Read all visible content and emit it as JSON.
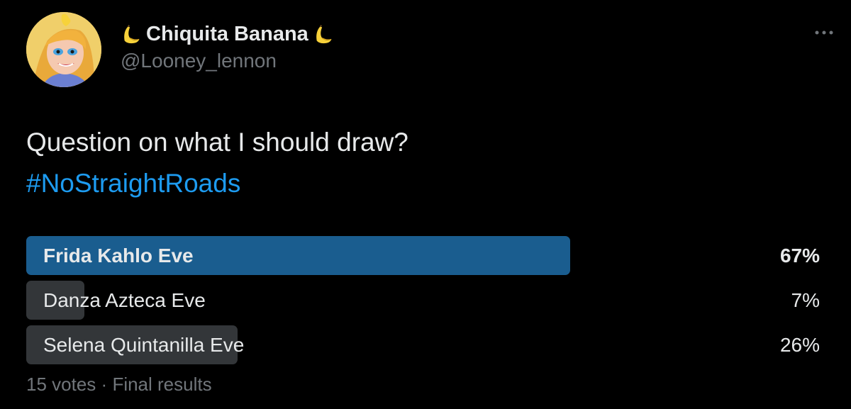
{
  "user": {
    "display_name": "Chiquita Banana",
    "name_emoji": "banana-emoji",
    "handle": "@Looney_lennon",
    "avatar": "cartoon-portrait-avatar"
  },
  "menu": {
    "icon": "more-options-icon"
  },
  "tweet": {
    "text": "Question on what I should draw?",
    "hashtag": "#NoStraightRoads"
  },
  "poll": {
    "options": [
      {
        "label": "Frida Kahlo Eve",
        "percent_text": "67%",
        "percent": 67,
        "winner": true
      },
      {
        "label": "Danza Azteca Eve",
        "percent_text": "7%",
        "percent": 7,
        "winner": false
      },
      {
        "label": "Selena Quintanilla Eve",
        "percent_text": "26%",
        "percent": 26,
        "winner": false
      }
    ],
    "votes": "15 votes",
    "separator": "·",
    "status": "Final results"
  },
  "colors": {
    "background": "#000000",
    "primary_text": "#e7e9ea",
    "secondary_text": "#71767b",
    "hashtag": "#1d9bf0",
    "winner_bar": "#1a5d8f",
    "other_bar": "#333639"
  }
}
